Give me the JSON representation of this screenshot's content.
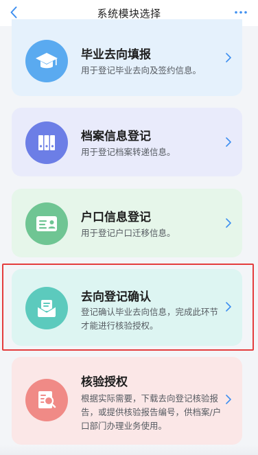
{
  "header": {
    "title": "系统模块选择"
  },
  "colors": {
    "accent_blue": "#3e8ff0",
    "highlight_red": "#e43c3c"
  },
  "modules": [
    {
      "title": "毕业去向填报",
      "desc": "用于登记毕业去向及签约信息。",
      "icon": "graduation-cap-icon",
      "bg": "#e5f1fc",
      "icon_color": "#5aaaf0"
    },
    {
      "title": "档案信息登记",
      "desc": "用于登记档案转递信息。",
      "icon": "archive-binder-icon",
      "bg": "#e9ebfb",
      "icon_color": "#6c7ee6"
    },
    {
      "title": "户口信息登记",
      "desc": "用于登记户口迁移信息。",
      "icon": "id-card-icon",
      "bg": "#e6f6ea",
      "icon_color": "#6fc593"
    },
    {
      "title": "去向登记确认",
      "desc": "登记确认毕业去向信息，完成此环节才能进行核验授权。",
      "icon": "envelope-document-icon",
      "bg": "#ddf5f2",
      "icon_color": "#5ccabd"
    },
    {
      "title": "核验授权",
      "desc": "根据实际需要，下载去向登记核验报告，或提供核验报告编号，供档案/户口部门办理业务使用。",
      "icon": "search-report-icon",
      "bg": "#fbe7e7",
      "icon_color": "#f08a86"
    }
  ]
}
